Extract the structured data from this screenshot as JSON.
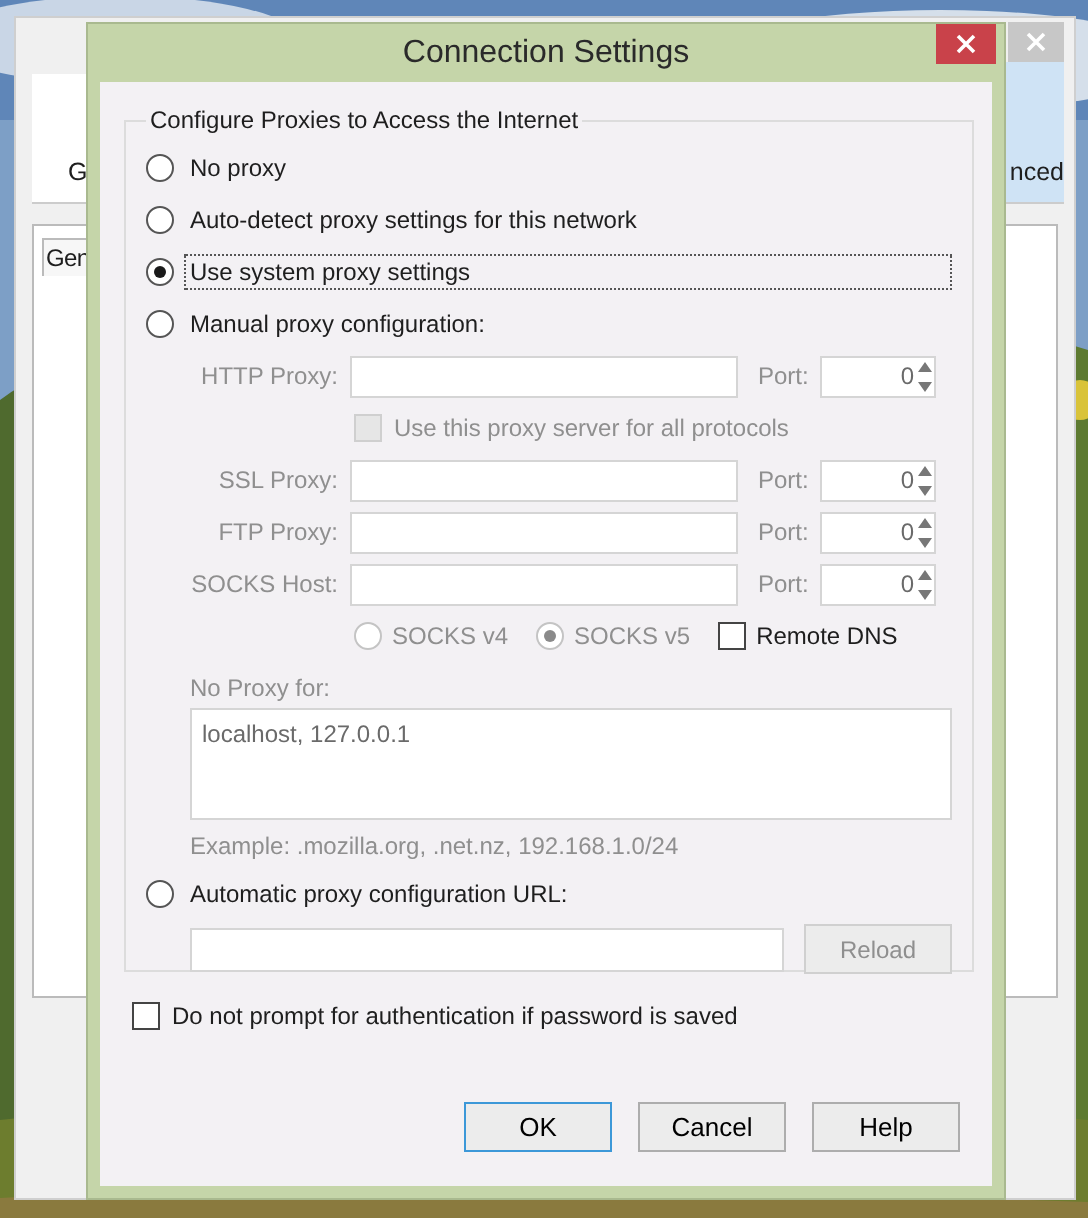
{
  "parent_window": {
    "tabs": [
      {
        "label": "G",
        "selected": false
      },
      {
        "label": "nced",
        "selected": true
      }
    ],
    "subtab": "Gen"
  },
  "dialog": {
    "title": "Connection Settings",
    "group_title": "Configure Proxies to Access the Internet",
    "modes": [
      {
        "label": "No proxy",
        "selected": false
      },
      {
        "label": "Auto-detect proxy settings for this network",
        "selected": false
      },
      {
        "label": "Use system proxy settings",
        "selected": true
      },
      {
        "label": "Manual proxy configuration:",
        "selected": false
      },
      {
        "label": "Automatic proxy configuration URL:",
        "selected": false
      }
    ],
    "manual": {
      "disabled": true,
      "proxies": [
        {
          "label": "HTTP Proxy:",
          "port_label": "Port:",
          "port": "0"
        },
        {
          "label": "SSL Proxy:",
          "port_label": "Port:",
          "port": "0"
        },
        {
          "label": "FTP Proxy:",
          "port_label": "Port:",
          "port": "0"
        },
        {
          "label": "SOCKS Host:",
          "port_label": "Port:",
          "port": "0"
        }
      ],
      "share_all": {
        "label": "Use this proxy server for all protocols",
        "checked": false
      },
      "socks_versions": [
        {
          "label": "SOCKS v4",
          "selected": false
        },
        {
          "label": "SOCKS v5",
          "selected": true
        }
      ],
      "remote_dns": {
        "label": "Remote DNS",
        "checked": false
      },
      "no_proxy_label": "No Proxy for:",
      "no_proxy_value": "localhost, 127.0.0.1",
      "example": "Example: .mozilla.org, .net.nz, 192.168.1.0/24"
    },
    "reload": {
      "label": "Reload",
      "disabled": true
    },
    "auth": {
      "label": "Do not prompt for authentication if password is saved",
      "checked": false
    },
    "buttons": [
      {
        "label": "OK",
        "default": true
      },
      {
        "label": "Cancel",
        "default": false
      },
      {
        "label": "Help",
        "default": false
      }
    ]
  }
}
